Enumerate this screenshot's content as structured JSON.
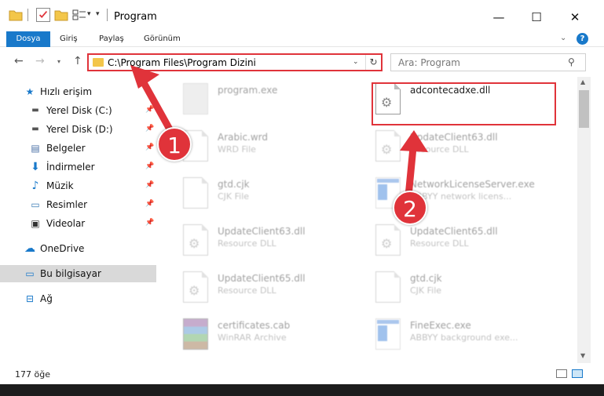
{
  "window": {
    "title": "Program",
    "controls": {
      "minimize": "—",
      "maximize": "☐",
      "close": "✕"
    }
  },
  "ribbon": {
    "file_tab": "Dosya",
    "tabs": [
      "Giriş",
      "Paylaş",
      "Görünüm"
    ],
    "help": "?"
  },
  "navbar": {
    "address": "C:\\Program Files\\Program Dizini",
    "search_placeholder": "Ara: Program"
  },
  "sidebar": {
    "quick_access": "Hızlı erişim",
    "items": [
      {
        "label": "Yerel Disk (C:)",
        "icon": "drive-icon"
      },
      {
        "label": "Yerel Disk (D:)",
        "icon": "drive-icon"
      },
      {
        "label": "Belgeler",
        "icon": "documents-icon"
      },
      {
        "label": "İndirmeler",
        "icon": "downloads-icon"
      },
      {
        "label": "Müzik",
        "icon": "music-icon"
      },
      {
        "label": "Resimler",
        "icon": "pictures-icon"
      },
      {
        "label": "Videolar",
        "icon": "videos-icon"
      }
    ],
    "onedrive": "OneDrive",
    "this_pc": "Bu bilgisayar",
    "network": "Ağ"
  },
  "files": [
    {
      "name": "program.exe",
      "type": "",
      "icon": "program-icon"
    },
    {
      "name": "adcontecadxe.dll",
      "type": "",
      "icon": "dll-icon"
    },
    {
      "name": "Arabic.wrd",
      "type": "WRD File",
      "icon": "document-icon"
    },
    {
      "name": "UpdateClient63.dll",
      "type": "Resource DLL",
      "icon": "dll-icon"
    },
    {
      "name": "gtd.cjk",
      "type": "CJK File",
      "icon": "document-icon"
    },
    {
      "name": "NetworkLicenseServer.exe",
      "type": "ABBYY network licens...",
      "icon": "exe-icon"
    },
    {
      "name": "UpdateClient63.dll",
      "type": "Resource DLL",
      "icon": "dll-icon"
    },
    {
      "name": "UpdateClient65.dll",
      "type": "Resource DLL",
      "icon": "dll-icon"
    },
    {
      "name": "UpdateClient65.dll",
      "type": "Resource DLL",
      "icon": "dll-icon"
    },
    {
      "name": "gtd.cjk",
      "type": "CJK File",
      "icon": "document-icon"
    },
    {
      "name": "certificates.cab",
      "type": "WinRAR Archive",
      "icon": "archive-icon"
    },
    {
      "name": "FineExec.exe",
      "type": "ABBYY background exe...",
      "icon": "exe-icon"
    }
  ],
  "status": {
    "count": "177 öğe"
  },
  "annotations": {
    "step1": "1",
    "step2": "2",
    "color": "#e0333a"
  }
}
